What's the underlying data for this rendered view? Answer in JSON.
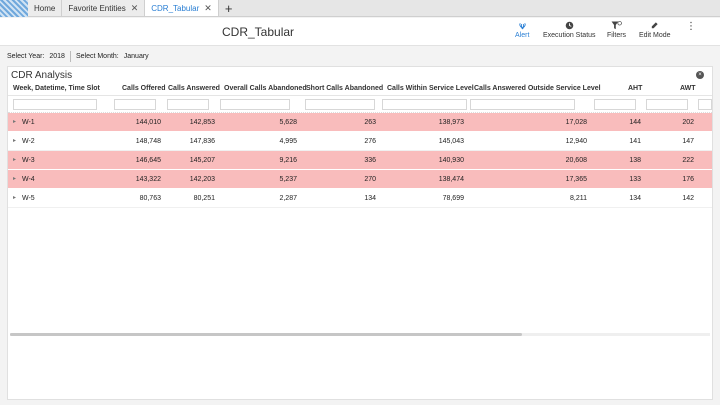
{
  "tabs": [
    {
      "label": "Home",
      "closable": false,
      "active": false
    },
    {
      "label": "Favorite Entities",
      "closable": true,
      "active": false
    },
    {
      "label": "CDR_Tabular",
      "closable": true,
      "active": true
    }
  ],
  "add_tab_symbol": "+",
  "close_symbol": "✕",
  "header": {
    "title": "CDR_Tabular",
    "tools": [
      {
        "label": "Alert",
        "icon": "alert-icon"
      },
      {
        "label": "Execution Status",
        "icon": "execution-status-icon"
      },
      {
        "label": "Filters",
        "icon": "filter-icon"
      },
      {
        "label": "Edit Mode",
        "icon": "edit-mode-icon"
      }
    ],
    "more_symbol": "⋮"
  },
  "params": {
    "year_label": "Select Year:",
    "year_value": "2018",
    "month_label": "Select Month:",
    "month_value": "January"
  },
  "panel": {
    "title": "CDR Analysis",
    "columns": [
      "Week, Datetime, Time Slot",
      "Calls Offered",
      "Calls Answered",
      "Overall Calls Abandoned",
      "Short Calls Abandoned",
      "Calls Within Service Level",
      "Calls Answered Outside Service Level",
      "AHT",
      "AWT"
    ],
    "rows": [
      {
        "label": "W-1",
        "highlight": true,
        "values": [
          "144,010",
          "142,853",
          "5,628",
          "263",
          "138,973",
          "17,028",
          "144",
          "202"
        ]
      },
      {
        "label": "W-2",
        "highlight": false,
        "values": [
          "148,748",
          "147,836",
          "4,995",
          "276",
          "145,043",
          "12,940",
          "141",
          "147"
        ]
      },
      {
        "label": "W-3",
        "highlight": true,
        "values": [
          "146,645",
          "145,207",
          "9,216",
          "336",
          "140,930",
          "20,608",
          "138",
          "222"
        ]
      },
      {
        "label": "W-4",
        "highlight": true,
        "values": [
          "143,322",
          "142,203",
          "5,237",
          "270",
          "138,474",
          "17,365",
          "133",
          "176"
        ]
      },
      {
        "label": "W-5",
        "highlight": false,
        "values": [
          "80,763",
          "80,251",
          "2,287",
          "134",
          "78,699",
          "8,211",
          "134",
          "142"
        ]
      }
    ],
    "expand_symbol": "▸",
    "colors": {
      "highlight": "#f9bcbc",
      "accent": "#2a7fd4"
    }
  }
}
